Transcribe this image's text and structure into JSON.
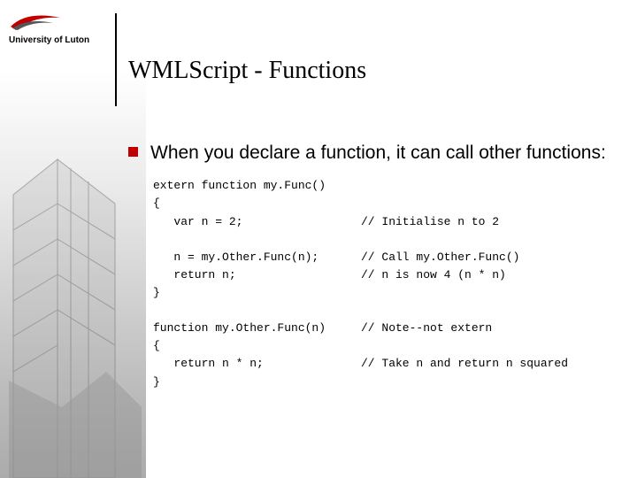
{
  "logo": {
    "name": "University of Luton"
  },
  "title": "WMLScript - Functions",
  "bullet": "When you declare a function, it can call other functions:",
  "code": {
    "lines": [
      {
        "l": "extern function my.Func()",
        "r": ""
      },
      {
        "l": "{",
        "r": ""
      },
      {
        "l": "   var n = 2;",
        "r": "// Initialise n to 2"
      },
      {
        "l": "",
        "r": "",
        "spacer": true
      },
      {
        "l": "   n = my.Other.Func(n);",
        "r": "// Call my.Other.Func()"
      },
      {
        "l": "   return n;",
        "r": "// n is now 4 (n * n)"
      },
      {
        "l": "}",
        "r": ""
      },
      {
        "l": "",
        "r": "",
        "spacer": true
      },
      {
        "l": "function my.Other.Func(n)",
        "r": "// Note--not extern"
      },
      {
        "l": "{",
        "r": ""
      },
      {
        "l": "   return n * n;",
        "r": "// Take n and return n squared"
      },
      {
        "l": "}",
        "r": ""
      }
    ]
  }
}
